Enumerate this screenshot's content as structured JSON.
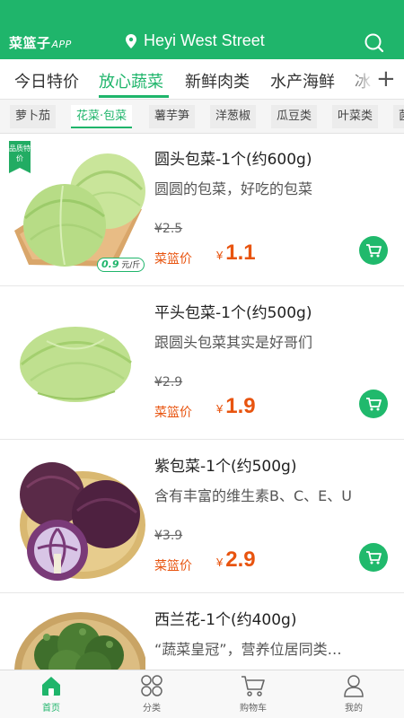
{
  "app": {
    "logo_text": "菜篮子",
    "logo_suffix": "APP",
    "location": "Heyi West Street"
  },
  "colors": {
    "brand_green": "#1fb56b",
    "price_orange": "#e8540f"
  },
  "icons": {
    "location": "map-pin-icon",
    "search": "search-icon",
    "add": "plus-icon",
    "cart": "cart-icon"
  },
  "categories": [
    {
      "label": "今日特价",
      "active": false
    },
    {
      "label": "放心蔬菜",
      "active": true
    },
    {
      "label": "新鲜肉类",
      "active": false
    },
    {
      "label": "水产海鲜",
      "active": false
    },
    {
      "label": "冰",
      "active": false
    }
  ],
  "subcategories": [
    {
      "label": "萝卜茄",
      "active": false
    },
    {
      "label": "花菜·包菜",
      "active": true
    },
    {
      "label": "薯芋笋",
      "active": false
    },
    {
      "label": "洋葱椒",
      "active": false
    },
    {
      "label": "瓜豆类",
      "active": false
    },
    {
      "label": "叶菜类",
      "active": false
    },
    {
      "label": "菌",
      "active": false
    }
  ],
  "products": [
    {
      "name": "圆头包菜-1个(约600g)",
      "desc": "圆圆的包菜，好吃的包菜",
      "old_price": "¥2.5",
      "price_label": "菜篮价",
      "currency": "¥",
      "price": "1.1",
      "badge": "品质特价",
      "unit_price": "0.9",
      "unit_suffix": "元/斤"
    },
    {
      "name": "平头包菜-1个(约500g)",
      "desc": "跟圆头包菜其实是好哥们",
      "old_price": "¥2.9",
      "price_label": "菜篮价",
      "currency": "¥",
      "price": "1.9"
    },
    {
      "name": "紫包菜-1个(约500g)",
      "desc": "含有丰富的维生素B、C、E、U",
      "old_price": "¥3.9",
      "price_label": "菜篮价",
      "currency": "¥",
      "price": "2.9"
    },
    {
      "name": "西兰花-1个(约400g)",
      "desc": "“蔬菜皇冠”，营养位居同类…"
    }
  ],
  "tabbar": [
    {
      "label": "首页",
      "icon": "home-icon",
      "active": true
    },
    {
      "label": "分类",
      "icon": "grid-icon",
      "active": false
    },
    {
      "label": "购物车",
      "icon": "cart-icon",
      "active": false
    },
    {
      "label": "我的",
      "icon": "user-icon",
      "active": false
    }
  ]
}
